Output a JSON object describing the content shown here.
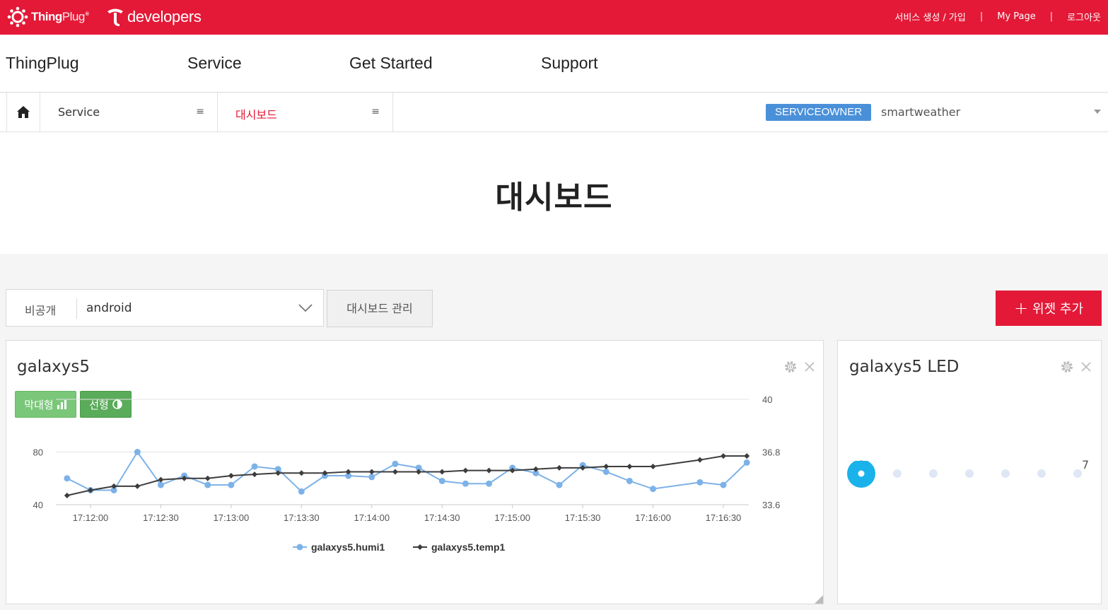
{
  "topbar": {
    "logo_thingplug_bold": "Thing",
    "logo_thingplug_light": "Plug",
    "logo_thingplug_reg": "®",
    "logo_developers": "developers",
    "links": [
      "서비스 생성 / 가입",
      "My Page",
      "로그아웃"
    ],
    "separator": "|"
  },
  "nav": {
    "items": [
      "ThingPlug",
      "Service",
      "Get Started",
      "Support"
    ]
  },
  "breadcrumb": {
    "service_label": "Service",
    "page_label": "대시보드",
    "menu_glyph": "≡",
    "role_badge": "SERVICEOWNER",
    "service_name": "smartweather"
  },
  "page": {
    "title": "대시보드"
  },
  "toolbar": {
    "visibility": "비공개",
    "dashboard_select": "android",
    "manage_button": "대시보드 관리",
    "add_widget_button": "위젯 추가",
    "add_icon": "+"
  },
  "chart_widget": {
    "title": "galaxys5",
    "bar_button": "막대형",
    "line_button": "선형"
  },
  "led_widget": {
    "title": "galaxys5 LED",
    "min_label": "0",
    "max_label": "7",
    "active_index": 0,
    "dot_count": 7
  },
  "colors": {
    "brand_red": "#e31937",
    "badge_blue": "#4a90d9",
    "humi_series": "#7db2e8",
    "temp_series": "#3d3d3d",
    "led_active": "#1ab2ea",
    "led_inactive": "#dfe7f5"
  },
  "chart_data": {
    "type": "line",
    "x": [
      "17:11:50",
      "17:12:00",
      "17:12:10",
      "17:12:20",
      "17:12:30",
      "17:12:40",
      "17:12:50",
      "17:13:00",
      "17:13:10",
      "17:13:20",
      "17:13:30",
      "17:13:40",
      "17:13:50",
      "17:14:00",
      "17:14:10",
      "17:14:20",
      "17:14:30",
      "17:14:40",
      "17:14:50",
      "17:15:00",
      "17:15:10",
      "17:15:20",
      "17:15:30",
      "17:15:40",
      "17:15:50",
      "17:16:00",
      "17:16:20",
      "17:16:30",
      "17:16:40"
    ],
    "x_tick_labels": [
      "17:12:00",
      "17:12:30",
      "17:13:00",
      "17:13:30",
      "17:14:00",
      "17:14:30",
      "17:15:00",
      "17:15:30",
      "17:16:00",
      "17:16:30"
    ],
    "y_left_ticks": [
      "40",
      "80"
    ],
    "y_right_ticks": [
      "33.6",
      "36.8",
      "40"
    ],
    "ylim_left": [
      40,
      120
    ],
    "ylim_right": [
      33.6,
      40
    ],
    "series": [
      {
        "name": "galaxys5.humi1",
        "axis": "left",
        "marker": "circle",
        "values": [
          60,
          51,
          51,
          80,
          55,
          62,
          55,
          55,
          69,
          67,
          50,
          62,
          62,
          61,
          71,
          68,
          58,
          56,
          56,
          68,
          64,
          55,
          70,
          65,
          58,
          52,
          57,
          55,
          72
        ]
      },
      {
        "name": "galaxys5.temp1",
        "axis": "left",
        "marker": "diamond",
        "values": [
          47,
          51,
          54,
          54,
          59,
          60,
          60,
          62,
          63,
          64,
          64,
          64,
          65,
          65,
          65,
          65,
          65,
          66,
          66,
          66,
          67,
          68,
          68,
          69,
          69,
          69,
          74,
          77,
          77
        ]
      }
    ]
  }
}
